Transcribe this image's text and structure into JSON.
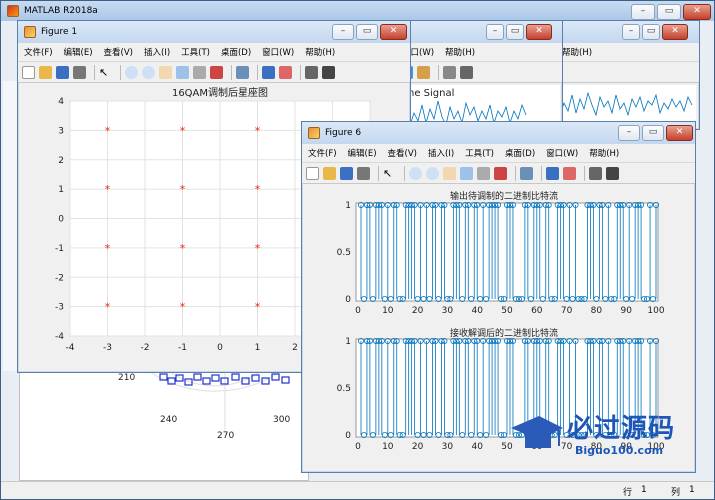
{
  "matlab": {
    "title": "MATLAB R2018a",
    "status_row_label": "行",
    "status_row_value": "1",
    "status_col_label": "列",
    "status_col_value": "1"
  },
  "polar": {
    "ticks": [
      "210",
      "240",
      "270",
      "300"
    ]
  },
  "fig1": {
    "title": "Figure 1",
    "menu": [
      "文件(F)",
      "编辑(E)",
      "查看(V)",
      "插入(I)",
      "工具(T)",
      "桌面(D)",
      "窗口(W)",
      "帮助(H)"
    ],
    "plot_title": "16QAM调制后星座图"
  },
  "fig_mid": {
    "menu": [
      "窗口(W)",
      "帮助(H)"
    ],
    "plot_title_fragment": "ne Signal"
  },
  "fig_back": {
    "menu": [
      "帮助(H)"
    ]
  },
  "fig6": {
    "title": "Figure 6",
    "menu": [
      "文件(F)",
      "编辑(E)",
      "查看(V)",
      "插入(I)",
      "工具(T)",
      "桌面(D)",
      "窗口(W)",
      "帮助(H)"
    ],
    "top_title": "输出待调制的二进制比特流",
    "bottom_title": "接收解调后的二进制比特流"
  },
  "watermark": {
    "brand": "必过源码",
    "site": "Biguo100.com"
  },
  "colors": {
    "marker": "#e8231c",
    "stem": "#0072bd",
    "matlab_blue": "#0072bd"
  },
  "chart_data": [
    {
      "type": "scatter",
      "title": "16QAM调制后星座图",
      "x_ticks": [
        "-4",
        "-3",
        "-2",
        "-1",
        "0",
        "1",
        "2"
      ],
      "y_ticks": [
        "4",
        "3",
        "2",
        "1",
        "0",
        "-1",
        "-2",
        "-3",
        "-4"
      ],
      "xlim": [
        -4,
        4
      ],
      "ylim": [
        -4,
        4
      ],
      "grid": true,
      "marker": "*",
      "points": [
        [
          -3,
          3
        ],
        [
          -1,
          3
        ],
        [
          1,
          3
        ],
        [
          -3,
          1
        ],
        [
          -1,
          1
        ],
        [
          1,
          1
        ],
        [
          -3,
          -1
        ],
        [
          -1,
          -1
        ],
        [
          1,
          -1
        ],
        [
          -3,
          -3
        ],
        [
          -1,
          -3
        ],
        [
          1,
          -3
        ]
      ]
    },
    {
      "type": "stem",
      "title": "输出待调制的二进制比特流",
      "x_ticks": [
        "0",
        "10",
        "20",
        "30",
        "40",
        "50",
        "60",
        "70",
        "80",
        "90",
        "100"
      ],
      "y_ticks": [
        "1",
        "0.5",
        "0"
      ],
      "xlim": [
        0,
        100
      ],
      "ylim": [
        0,
        1
      ],
      "values": [
        1,
        0,
        1,
        1,
        0,
        1,
        1,
        1,
        0,
        1,
        0,
        1,
        1,
        0,
        0,
        1,
        1,
        1,
        1,
        0,
        1,
        0,
        1,
        0,
        1,
        1,
        0,
        1,
        1,
        0,
        0,
        1,
        1,
        1,
        0,
        1,
        1,
        0,
        1,
        1,
        0,
        1,
        0,
        1,
        1,
        1,
        1,
        0,
        0,
        1,
        1,
        1,
        0,
        0,
        0,
        1,
        1,
        0,
        1,
        1,
        1,
        0,
        1,
        1,
        0,
        0,
        1,
        1,
        1,
        0,
        1,
        0,
        1,
        0,
        0,
        0,
        1,
        1,
        1,
        0,
        1,
        1,
        0,
        1,
        0,
        0,
        1,
        1,
        1,
        0,
        1,
        0,
        1,
        1,
        1,
        0,
        0,
        1,
        0,
        1
      ]
    },
    {
      "type": "stem",
      "title": "接收解调后的二进制比特流",
      "x_ticks": [
        "0",
        "10",
        "20",
        "30",
        "40",
        "50",
        "60",
        "70",
        "80",
        "90",
        "100"
      ],
      "y_ticks": [
        "1",
        "0.5",
        "0"
      ],
      "xlim": [
        0,
        100
      ],
      "ylim": [
        0,
        1
      ],
      "values": [
        1,
        0,
        1,
        1,
        0,
        1,
        1,
        1,
        0,
        1,
        0,
        1,
        1,
        0,
        0,
        1,
        1,
        1,
        1,
        0,
        1,
        0,
        1,
        0,
        1,
        1,
        0,
        1,
        1,
        0,
        0,
        1,
        1,
        1,
        0,
        1,
        1,
        0,
        1,
        1,
        0,
        1,
        0,
        1,
        1,
        1,
        1,
        0,
        0,
        1,
        1,
        1,
        0,
        0,
        0,
        1,
        1,
        0,
        1,
        1,
        1,
        0,
        1,
        1,
        0,
        0,
        1,
        1,
        1,
        0,
        1,
        0,
        1,
        0,
        0,
        0,
        1,
        1,
        1,
        0,
        1,
        1,
        0,
        1,
        0,
        0,
        1,
        1,
        1,
        0,
        1,
        0,
        1,
        1,
        1,
        0,
        0,
        1,
        0,
        1
      ]
    }
  ]
}
